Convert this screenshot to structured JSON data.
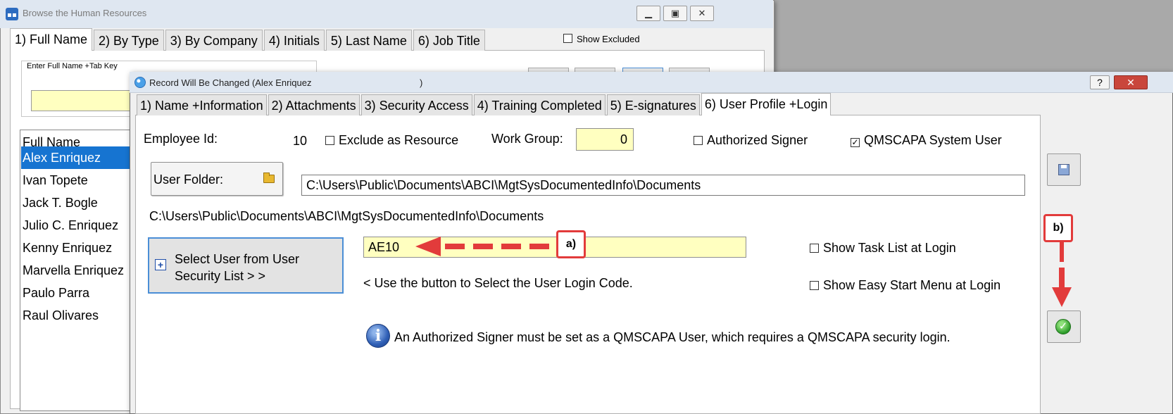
{
  "back_window": {
    "title": "Browse the Human Resources",
    "controls": {
      "minimize": "▁",
      "maximize": "▣",
      "close": "✕"
    },
    "tabs": [
      "1) Full Name",
      "2) By Type",
      "3) By Company",
      "4) Initials",
      "5) Last Name",
      "6) Job Title"
    ],
    "show_excluded": "Show Excluded",
    "search_label": "Enter Full Name +Tab Key",
    "search_value": "",
    "list_header": "Full Name",
    "names": [
      "Alex Enriquez",
      "Ivan Topete",
      "Jack T. Bogle",
      "Julio C. Enriquez",
      "Kenny Enriquez",
      "Marvella Enriquez",
      "Paulo Parra",
      "Raul Olivares"
    ],
    "selected_name": "Alex Enriquez"
  },
  "dialog": {
    "title": "Record Will Be Changed  (Alex Enriquez",
    "title_close": ")",
    "help_label": "?",
    "close_label": "✕",
    "tabs": [
      "1) Name +Information",
      "2) Attachments",
      "3) Security Access",
      "4) Training Completed",
      "5) E-signatures",
      "6) User Profile +Login"
    ],
    "active_tab": "6) User Profile +Login",
    "employee_id_label": "Employee Id:",
    "employee_id": "10",
    "exclude_resource": {
      "label": "Exclude as Resource",
      "checked": false
    },
    "work_group_label": "Work Group:",
    "work_group_value": "0",
    "authorized_signer": {
      "label": "Authorized Signer",
      "checked": false
    },
    "qmscapa_user": {
      "label": "QMSCAPA System User",
      "checked": true
    },
    "user_folder_label": "User Folder:",
    "user_folder_path": "C:\\Users\\Public\\Documents\\ABCI\\MgtSysDocumentedInfo\\Documents",
    "user_folder_display": "C:\\Users\\Public\\Documents\\ABCI\\MgtSysDocumentedInfo\\Documents",
    "select_user_button": "Select User from User Security List > >",
    "login_code": "AE10",
    "hint": "<  Use the button to Select the User Login Code.",
    "show_task_list": {
      "label": "Show Task List at Login",
      "checked": false
    },
    "show_easy_start": {
      "label": "Show Easy Start Menu at Login",
      "checked": false
    },
    "info_message": "An Authorized Signer must be set as a QMSCAPA User, which requires a QMSCAPA security login."
  },
  "annotations": {
    "a": "a)",
    "b": "b)"
  },
  "colors": {
    "annotation_red": "#e23b3b",
    "selection_blue": "#1674d1",
    "input_yellow": "#ffffc0"
  }
}
